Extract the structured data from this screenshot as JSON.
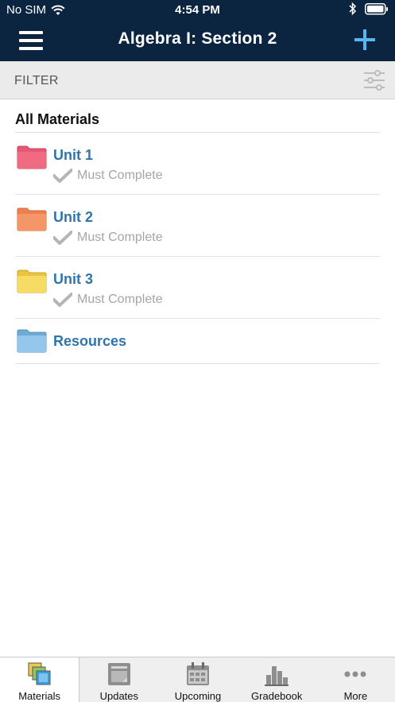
{
  "status_bar": {
    "carrier": "No SIM",
    "time": "4:54 PM"
  },
  "nav": {
    "title": "Algebra I: Section 2"
  },
  "filter": {
    "label": "FILTER"
  },
  "materials": {
    "heading": "All Materials",
    "items": [
      {
        "name": "Unit 1",
        "status": "Must Complete",
        "folder_color": "#e8566f"
      },
      {
        "name": "Unit 2",
        "status": "Must Complete",
        "folder_color": "#f08a5a"
      },
      {
        "name": "Unit 3",
        "status": "Must Complete",
        "folder_color": "#f2d55a"
      },
      {
        "name": "Resources",
        "status": "",
        "folder_color": "#7fb9e4"
      }
    ]
  },
  "tabs": [
    {
      "label": "Materials",
      "icon": "materials-icon",
      "active": true
    },
    {
      "label": "Updates",
      "icon": "updates-icon",
      "active": false
    },
    {
      "label": "Upcoming",
      "icon": "calendar-icon",
      "active": false
    },
    {
      "label": "Gradebook",
      "icon": "gradebook-icon",
      "active": false
    },
    {
      "label": "More",
      "icon": "more-icon",
      "active": false
    }
  ]
}
